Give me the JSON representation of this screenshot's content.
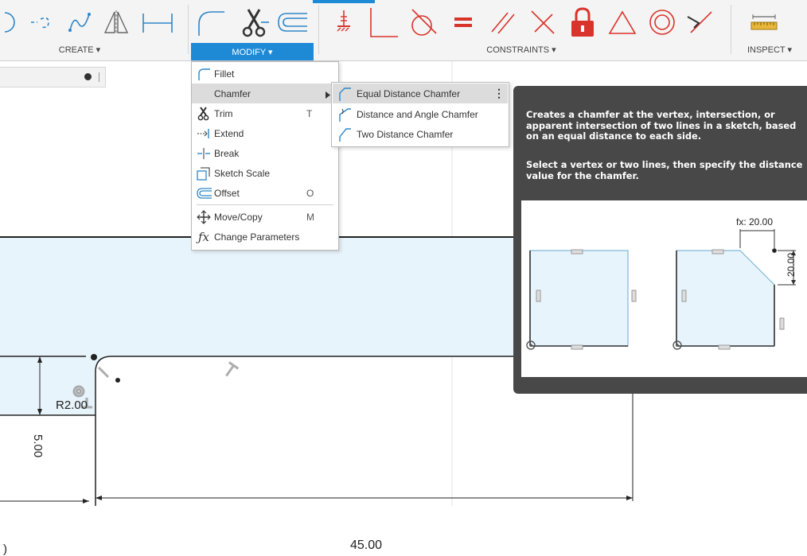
{
  "toolbar": {
    "groups": {
      "create": "CREATE ▾",
      "modify": "MODIFY ▾",
      "constraints": "CONSTRAINTS ▾",
      "inspect": "INSPECT ▾"
    },
    "icons": [
      "circle-icon",
      "spline-icon",
      "conic-curve-icon",
      "mirror-triangle-icon",
      "dimension-bar-icon",
      "fillet-icon",
      "trim-scissors-icon",
      "offset-icon",
      "fix-ground-icon",
      "coincident-icon",
      "tangent-icon",
      "equal-icon",
      "parallel-icon",
      "perpendicular-icon",
      "fix-lock-icon",
      "triangle-icon",
      "concentric-icon",
      "midpoint-icon",
      "measure-ruler-icon"
    ],
    "accent": "#1e8ad6"
  },
  "modify_menu": {
    "items": [
      {
        "label": "Fillet",
        "shortcut": "",
        "icon": "fillet-icon"
      },
      {
        "label": "Chamfer",
        "shortcut": "",
        "icon": "chamfer-icon",
        "has_submenu": true
      },
      {
        "label": "Trim",
        "shortcut": "T",
        "icon": "scissors-icon"
      },
      {
        "label": "Extend",
        "shortcut": "",
        "icon": "extend-icon"
      },
      {
        "label": "Break",
        "shortcut": "",
        "icon": "break-icon"
      },
      {
        "label": "Sketch Scale",
        "shortcut": "",
        "icon": "scale-icon"
      },
      {
        "label": "Offset",
        "shortcut": "O",
        "icon": "offset-icon"
      },
      {
        "label": "Move/Copy",
        "shortcut": "M",
        "icon": "move-icon"
      },
      {
        "label": "Change Parameters",
        "shortcut": "",
        "icon": "fx-icon"
      }
    ]
  },
  "chamfer_submenu": {
    "items": [
      {
        "label": "Equal Distance Chamfer",
        "icon": "equal-chamfer-icon"
      },
      {
        "label": "Distance and Angle Chamfer",
        "icon": "angle-chamfer-icon"
      },
      {
        "label": "Two Distance Chamfer",
        "icon": "two-distance-chamfer-icon"
      }
    ],
    "more_glyph": "⋮"
  },
  "tooltip": {
    "paragraph1": "Creates a chamfer at the vertex, intersection, or apparent intersection of two lines in a sketch, based on an equal distance to each side.",
    "paragraph2": "Select a vertex or two lines, then specify the distance value for the chamfer.",
    "fx_label": "fx: 20.00",
    "dim_label": "20.00"
  },
  "sketch": {
    "radius_label": "R2.00",
    "vertical_dim": "5.00",
    "horizontal_dim": "45.00",
    "partial_dim": ")"
  },
  "colors": {
    "sketch_fill": "#e8f4fb",
    "constraint_red": "#d9342b",
    "tooltip_bg": "#484848"
  }
}
